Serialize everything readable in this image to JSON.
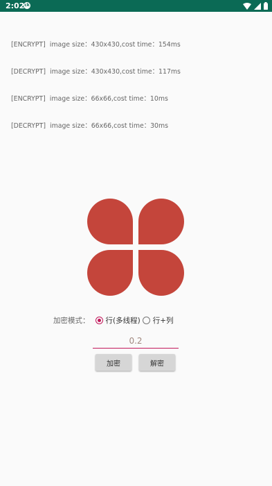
{
  "status_bar": {
    "time": "2:02",
    "notification_icon": "ck-badge-icon",
    "notification_text": "ck",
    "icons": [
      "wifi-icon",
      "signal-icon",
      "battery-icon"
    ]
  },
  "log_lines": [
    "[ENCRYPT]  image size：430x430,cost time：154ms",
    "[DECRYPT]  image size：430x430,cost time：117ms",
    "[ENCRYPT]  image size：66x66,cost time：10ms",
    "[DECRYPT]  image size：66x66,cost time：30ms"
  ],
  "image": {
    "icon": "four-petal-clover-icon",
    "color": "#c4453b"
  },
  "mode": {
    "label": "加密模式：",
    "options": [
      {
        "label": "行(多线程)",
        "checked": true
      },
      {
        "label": "行+列",
        "checked": false
      }
    ],
    "accent_color": "#c2185b"
  },
  "ratio_input": {
    "value": "0.2"
  },
  "buttons": {
    "encrypt_label": "加密",
    "decrypt_label": "解密"
  },
  "colors": {
    "status_bar": "#0b6a55",
    "background": "#fafafa"
  }
}
